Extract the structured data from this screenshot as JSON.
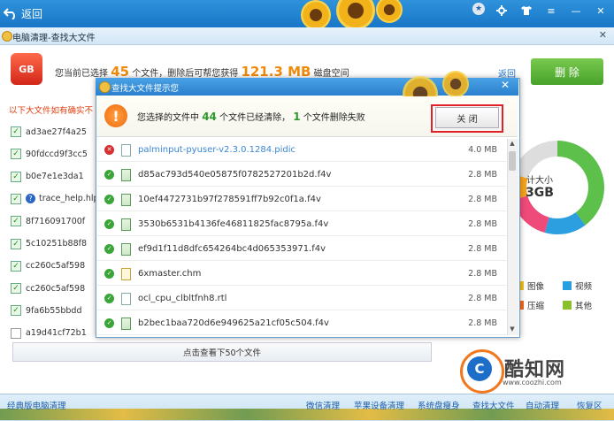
{
  "header": {
    "back_label": "返回"
  },
  "subbar": {
    "title": "电脑清理-查找大文件"
  },
  "summary": {
    "prefix": "您当前已选择",
    "count": "45",
    "mid": "个文件，删除后可帮您获得",
    "size": "121.3 MB",
    "suffix": "磁盘空间"
  },
  "return_link": "返回",
  "delete_label": "删 除",
  "hint": "以下大文件如有确实不",
  "left_list": [
    {
      "name": "ad3ae27f4a25",
      "checked": true,
      "icon": "check"
    },
    {
      "name": "90fdccd9f3cc5",
      "checked": true,
      "icon": "check"
    },
    {
      "name": "b0e7e1e3da1",
      "checked": true,
      "icon": "check"
    },
    {
      "name": "trace_help.hlp",
      "checked": true,
      "icon": "question"
    },
    {
      "name": "8f716091700f",
      "checked": true,
      "icon": "check"
    },
    {
      "name": "5c10251b88f8",
      "checked": true,
      "icon": "check"
    },
    {
      "name": "cc260c5af598",
      "checked": true,
      "icon": "check"
    },
    {
      "name": "cc260c5af598",
      "checked": true,
      "icon": "check"
    },
    {
      "name": "9fa6b55bbdd",
      "checked": true,
      "icon": "check"
    },
    {
      "name": "a19d41cf72b1",
      "checked": false,
      "icon": "check"
    }
  ],
  "view_next": "点击查看下50个文件",
  "ring": {
    "line1": "计大小",
    "line2": "3GB",
    "colors": {
      "green": "#5cc04a",
      "blue": "#2c9fe0",
      "pink": "#ee4a7a",
      "orange": "#f6a21a",
      "grey": "#dddddd"
    }
  },
  "legend": [
    {
      "label": "图像",
      "color": "#f0c020"
    },
    {
      "label": "视频",
      "color": "#2a9fe0"
    },
    {
      "label": "压缩",
      "color": "#f06a20"
    },
    {
      "label": "其他",
      "color": "#8ac02a"
    }
  ],
  "dialog": {
    "title": "查找大文件提示您",
    "msg_prefix": "您选择的文件中",
    "ok_count": "44",
    "msg_mid": "个文件已经清除，",
    "fail_count": "1",
    "msg_suffix": "个文件删除失败",
    "close_label": "关 闭",
    "files": [
      {
        "name": "palminput-pyuser-v2.3.0.1284.pidic",
        "size": "4.0 MB",
        "status": "error",
        "type": "file"
      },
      {
        "name": "d85ac793d540e05875f0782527201b2d.f4v",
        "size": "2.8 MB",
        "status": "ok",
        "type": "doc"
      },
      {
        "name": "10ef4472731b97f278591ff7b92c0f1a.f4v",
        "size": "2.8 MB",
        "status": "ok",
        "type": "doc"
      },
      {
        "name": "3530b6531b4136fe46811825fac8795a.f4v",
        "size": "2.8 MB",
        "status": "ok",
        "type": "doc"
      },
      {
        "name": "ef9d1f11d8dfc654264bc4d065353971.f4v",
        "size": "2.8 MB",
        "status": "ok",
        "type": "doc"
      },
      {
        "name": "6xmaster.chm",
        "size": "2.8 MB",
        "status": "ok",
        "type": "help"
      },
      {
        "name": "ocl_cpu_clbltfnh8.rtl",
        "size": "2.8 MB",
        "status": "ok",
        "type": "file"
      },
      {
        "name": "b2bec1baa720d6e949625a21cf05c504.f4v",
        "size": "2.8 MB",
        "status": "ok",
        "type": "doc"
      }
    ]
  },
  "watermark": {
    "text": "酷知网",
    "url": "www.coozhi.com",
    "logo": "C"
  },
  "bottom_nav": {
    "left": "经典版电脑清理",
    "items": [
      "微信清理",
      "苹果设备清理",
      "系统盘瘦身",
      "查找大文件",
      "自动清理",
      "恢复区"
    ]
  }
}
